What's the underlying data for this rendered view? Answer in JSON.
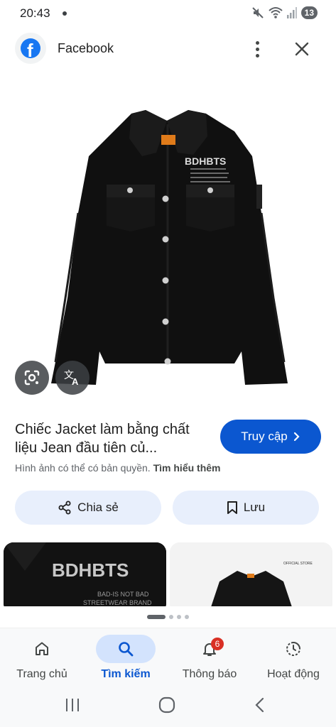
{
  "status_bar": {
    "time": "20:43",
    "battery": "13"
  },
  "header": {
    "source": "Facebook"
  },
  "image": {
    "brand_text": "BDHBTS"
  },
  "result": {
    "title": "Chiếc Jacket làm bằng chất liệu Jean đầu tiên củ...",
    "visit_label": "Truy cập",
    "copyright_text": "Hình ảnh có thể có bản quyền.",
    "learn_more": "Tìm hiểu thêm"
  },
  "actions": {
    "share_label": "Chia sẻ",
    "save_label": "Lưu"
  },
  "related": {
    "card1_brand": "BDHBTS",
    "card1_sub": "BAD-IS NOT BAD",
    "card1_sub2": "STREETWEAR BRAND",
    "card2_logo": "OFFICIAL STORE"
  },
  "bottom_nav": {
    "items": [
      {
        "label": "Trang chủ",
        "icon": "home-icon"
      },
      {
        "label": "Tìm kiếm",
        "icon": "search-icon"
      },
      {
        "label": "Thông báo",
        "icon": "bell-icon",
        "badge": "6"
      },
      {
        "label": "Hoạt động",
        "icon": "activity-icon"
      }
    ]
  },
  "colors": {
    "accent": "#0b57d0",
    "pill": "#e8effc",
    "nav_active": "#d3e3fd",
    "badge": "#d93025"
  }
}
